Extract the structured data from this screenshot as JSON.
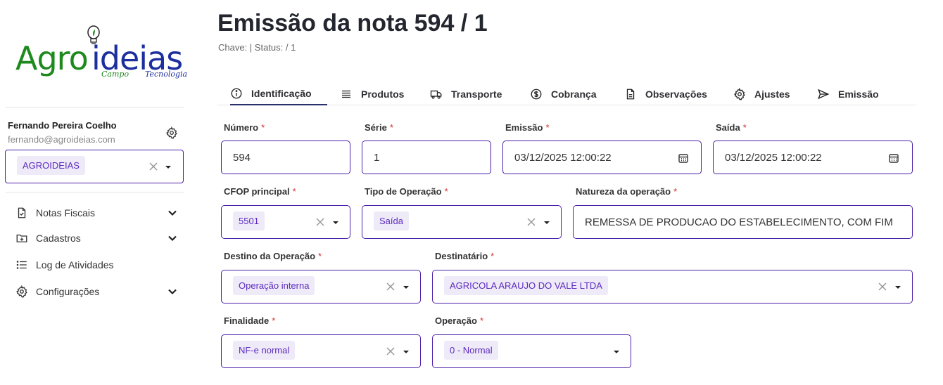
{
  "brand": {
    "word_agro": "Agro",
    "word_ideias": "ideias",
    "sub_campo": "Campo",
    "sub_tecnologia": "Tecnologia",
    "color_green": "#1e8a1e",
    "color_blue": "#1d2f9e"
  },
  "user": {
    "name": "Fernando Pereira Coelho",
    "email": "fernando@agroideias.com",
    "company": "AGROIDEIAS"
  },
  "nav": {
    "items": [
      {
        "label": "Notas Fiscais",
        "icon": "file-check-icon",
        "expandable": true
      },
      {
        "label": "Cadastros",
        "icon": "folder-plus-icon",
        "expandable": true
      },
      {
        "label": "Log de Atividades",
        "icon": "list-icon",
        "expandable": false
      },
      {
        "label": "Configurações",
        "icon": "gear-icon",
        "expandable": true
      }
    ]
  },
  "page": {
    "title": "Emissão da nota 594 / 1",
    "subtitle": "Chave: | Status: / 1"
  },
  "tabs": [
    {
      "label": "Identificação",
      "icon": "info-icon",
      "active": true
    },
    {
      "label": "Produtos",
      "icon": "list-icon",
      "active": false
    },
    {
      "label": "Transporte",
      "icon": "truck-icon",
      "active": false
    },
    {
      "label": "Cobrança",
      "icon": "dollar-icon",
      "active": false
    },
    {
      "label": "Observações",
      "icon": "document-icon",
      "active": false
    },
    {
      "label": "Ajustes",
      "icon": "gear-icon",
      "active": false
    },
    {
      "label": "Emissão",
      "icon": "send-icon",
      "active": false
    }
  ],
  "form": {
    "required_mark": "*",
    "numero": {
      "label": "Número",
      "value": "594"
    },
    "serie": {
      "label": "Série",
      "value": "1"
    },
    "emissao": {
      "label": "Emissão",
      "value": "03/12/2025 12:00:22"
    },
    "saida": {
      "label": "Saída",
      "value": "03/12/2025 12:00:22"
    },
    "cfop": {
      "label": "CFOP principal",
      "value": "5501"
    },
    "tipo_operacao": {
      "label": "Tipo de Operação",
      "value": "Saída"
    },
    "natureza": {
      "label": "Natureza da operação",
      "value": "REMESSA DE PRODUCAO DO ESTABELECIMENTO, COM FIM"
    },
    "destino": {
      "label": "Destino da Operação",
      "value": "Operação interna"
    },
    "destinatario": {
      "label": "Destinatário",
      "value": "AGRICOLA ARAUJO DO VALE LTDA"
    },
    "finalidade": {
      "label": "Finalidade",
      "value": "NF-e normal"
    },
    "operacao": {
      "label": "Operação",
      "value": "0 - Normal"
    }
  },
  "colors": {
    "accent": "#4b1fa8",
    "chip_bg": "#efeaf8",
    "chip_text": "#5b2bc0",
    "required": "#d0342c"
  }
}
